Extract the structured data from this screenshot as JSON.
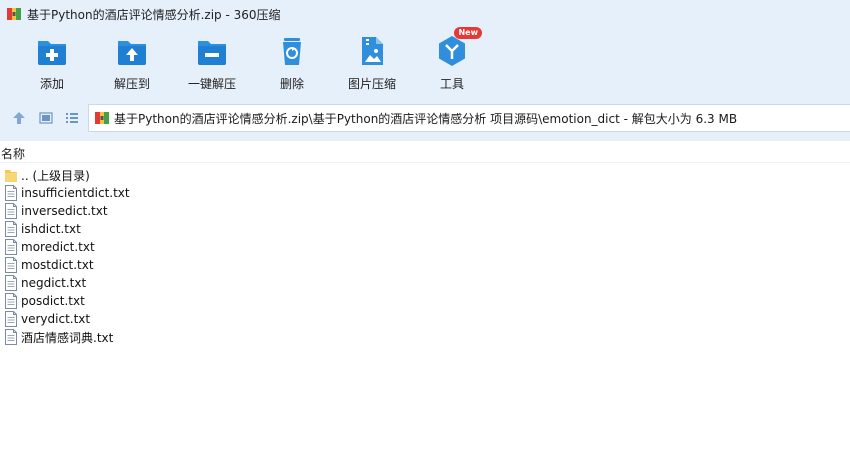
{
  "window": {
    "title": "基于Python的酒店评论情感分析.zip - 360压缩"
  },
  "toolbar": {
    "items": [
      {
        "label": "添加",
        "icon": "add-icon"
      },
      {
        "label": "解压到",
        "icon": "extract-to-icon"
      },
      {
        "label": "一键解压",
        "icon": "one-click-extract-icon"
      },
      {
        "label": "删除",
        "icon": "delete-icon"
      },
      {
        "label": "图片压缩",
        "icon": "image-compress-icon"
      },
      {
        "label": "工具",
        "icon": "tools-icon",
        "badge": "New"
      }
    ]
  },
  "address": {
    "path": "基于Python的酒店评论情感分析.zip\\基于Python的酒店评论情感分析 项目源码\\emotion_dict - 解包大小为 6.3 MB"
  },
  "list": {
    "column_name": "名称",
    "parent_label": ".. (上级目录)",
    "files": [
      "insufficientdict.txt",
      "inversedict.txt",
      "ishdict.txt",
      "moredict.txt",
      "mostdict.txt",
      "negdict.txt",
      "posdict.txt",
      "verydict.txt",
      "酒店情感词典.txt"
    ]
  },
  "colors": {
    "toolbar_bg": "#e6f0fb",
    "icon_blue": "#2f8fdc",
    "badge_red": "#e53935",
    "folder_yellow": "#f3c75a"
  }
}
